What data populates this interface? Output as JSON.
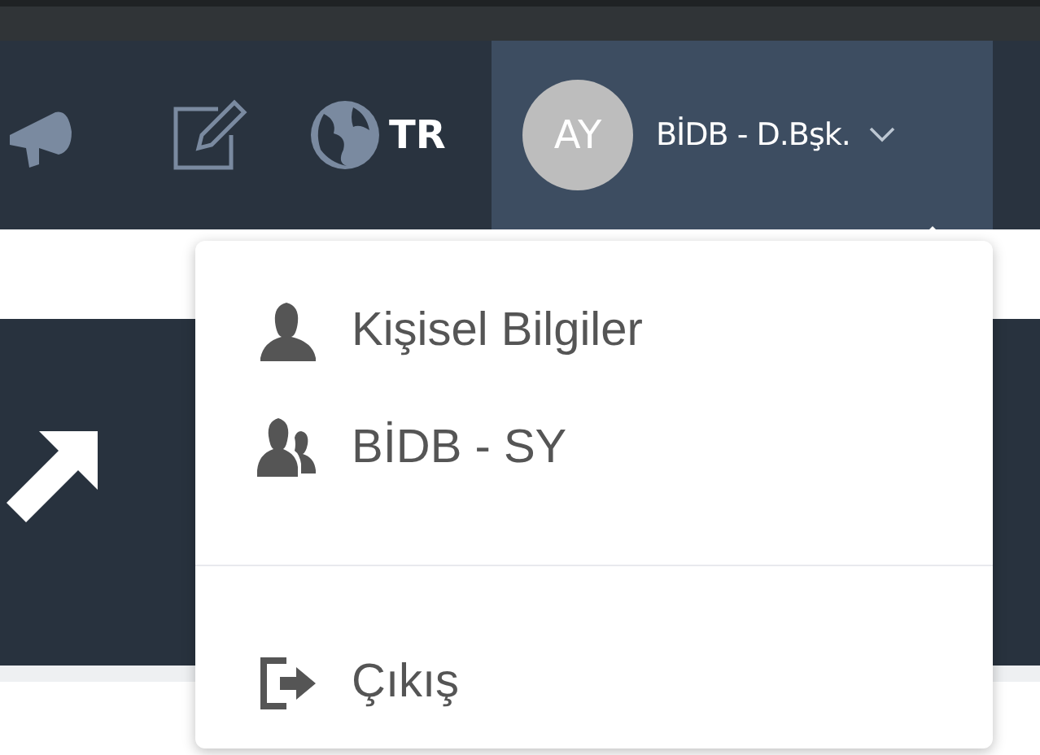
{
  "navbar": {
    "language": "TR",
    "user": {
      "initials": "AY",
      "name": "BİDB - D.Bşk.",
      "expanded": true
    }
  },
  "user_menu": {
    "items": [
      {
        "kind": "person",
        "label": "Kişisel Bilgiler"
      },
      {
        "kind": "group",
        "label": "BİDB - SY"
      },
      {
        "kind": "logout",
        "label": "Çıkış"
      }
    ]
  }
}
